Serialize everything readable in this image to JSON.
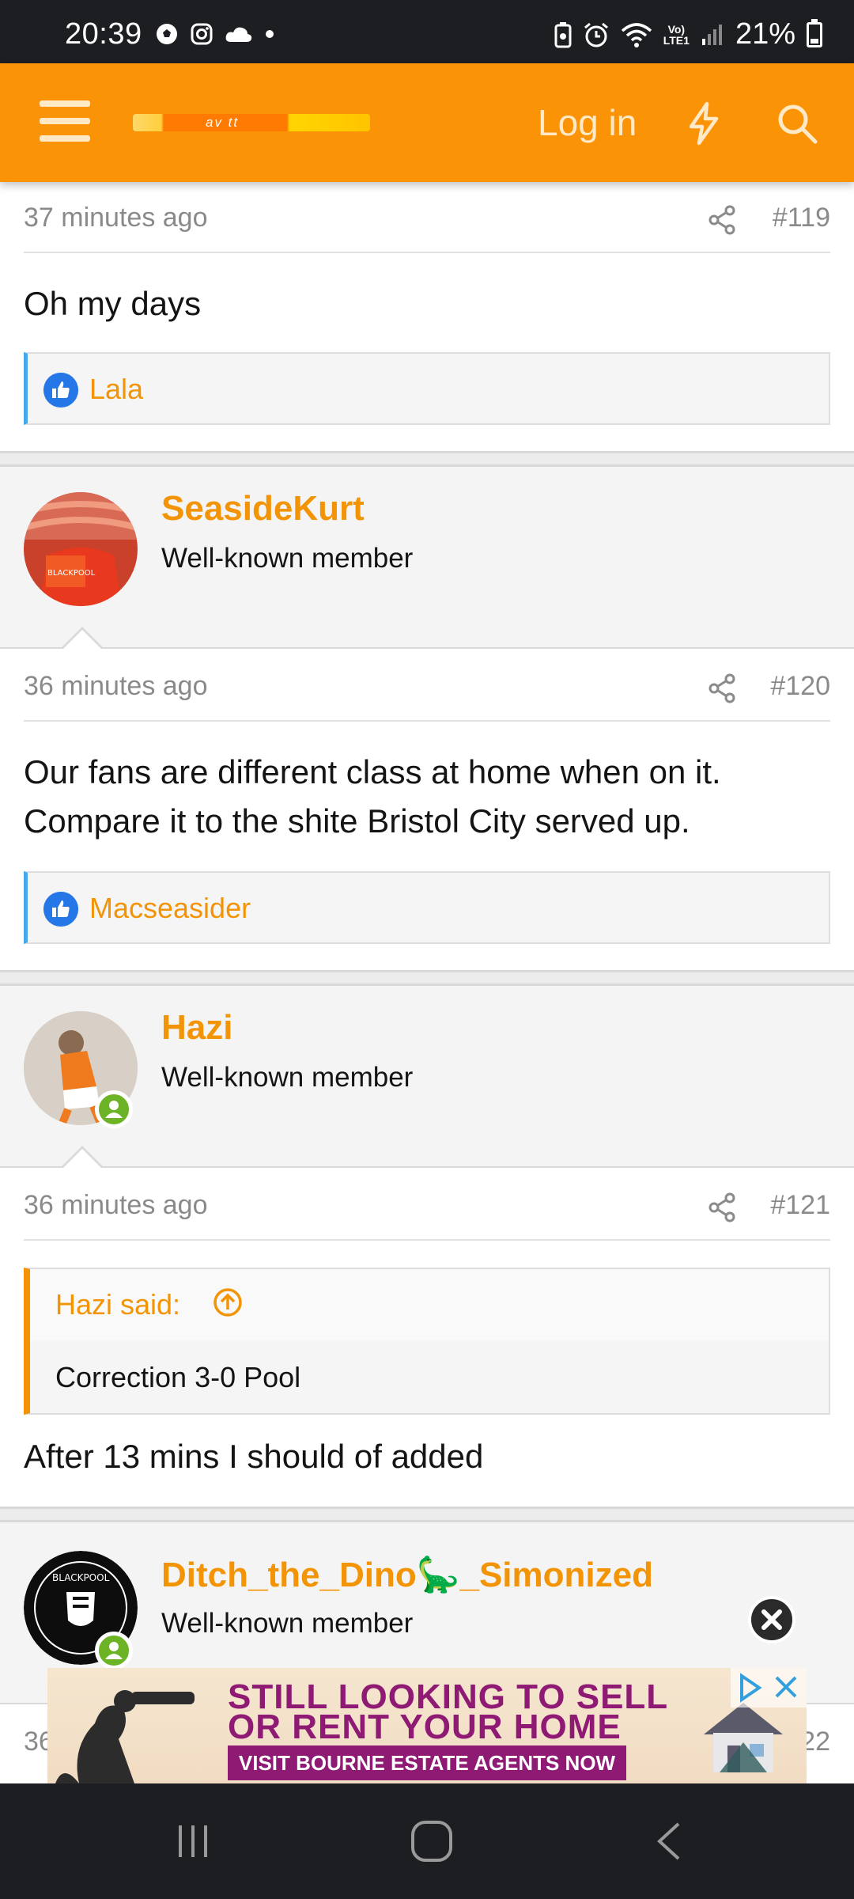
{
  "status_bar": {
    "time": "20:39",
    "battery": "21%",
    "network_label": "Vo)\nLTE1"
  },
  "header": {
    "logo_text": "av tt",
    "login_label": "Log in"
  },
  "posts": [
    {
      "time": "37 minutes ago",
      "number": "#119",
      "text": "Oh my days",
      "reaction_user": "Lala"
    },
    {
      "username": "SeasideKurt",
      "user_title": "Well-known member",
      "time": "36 minutes ago",
      "number": "#120",
      "text_lines": [
        "Our fans are different class at home when on it.",
        "Compare it to the shite Bristol City served up."
      ],
      "reaction_user": "Macseasider"
    },
    {
      "username": "Hazi",
      "user_title": "Well-known member",
      "time": "36 minutes ago",
      "number": "#121",
      "quote_author": "Hazi said:",
      "quote_text": "Correction 3-0 Pool",
      "text": "After 13 mins I should of added"
    },
    {
      "username": "Ditch_the_Dino🦕_Simonized",
      "user_title": "Well-known member",
      "time_partial": "36",
      "number_partial": "22"
    }
  ],
  "ad": {
    "line1": "STILL LOOKING TO SELL",
    "line2": "OR RENT YOUR HOME",
    "cta": "VISIT BOURNE ESTATE AGENTS NOW"
  },
  "colors": {
    "accent": "#fb9307",
    "link": "#f39406",
    "like": "#2577e8",
    "online": "#6cb325"
  },
  "icons": [
    "soccer-icon",
    "instagram-icon",
    "cloud-icon",
    "alarm-icon",
    "wifi-icon",
    "signal-icon",
    "battery-icon",
    "menu-icon",
    "bolt-icon",
    "search-icon",
    "share-icon",
    "like-icon",
    "arrow-up-circle-icon",
    "close-icon",
    "recent-apps-icon",
    "home-icon",
    "back-icon"
  ]
}
